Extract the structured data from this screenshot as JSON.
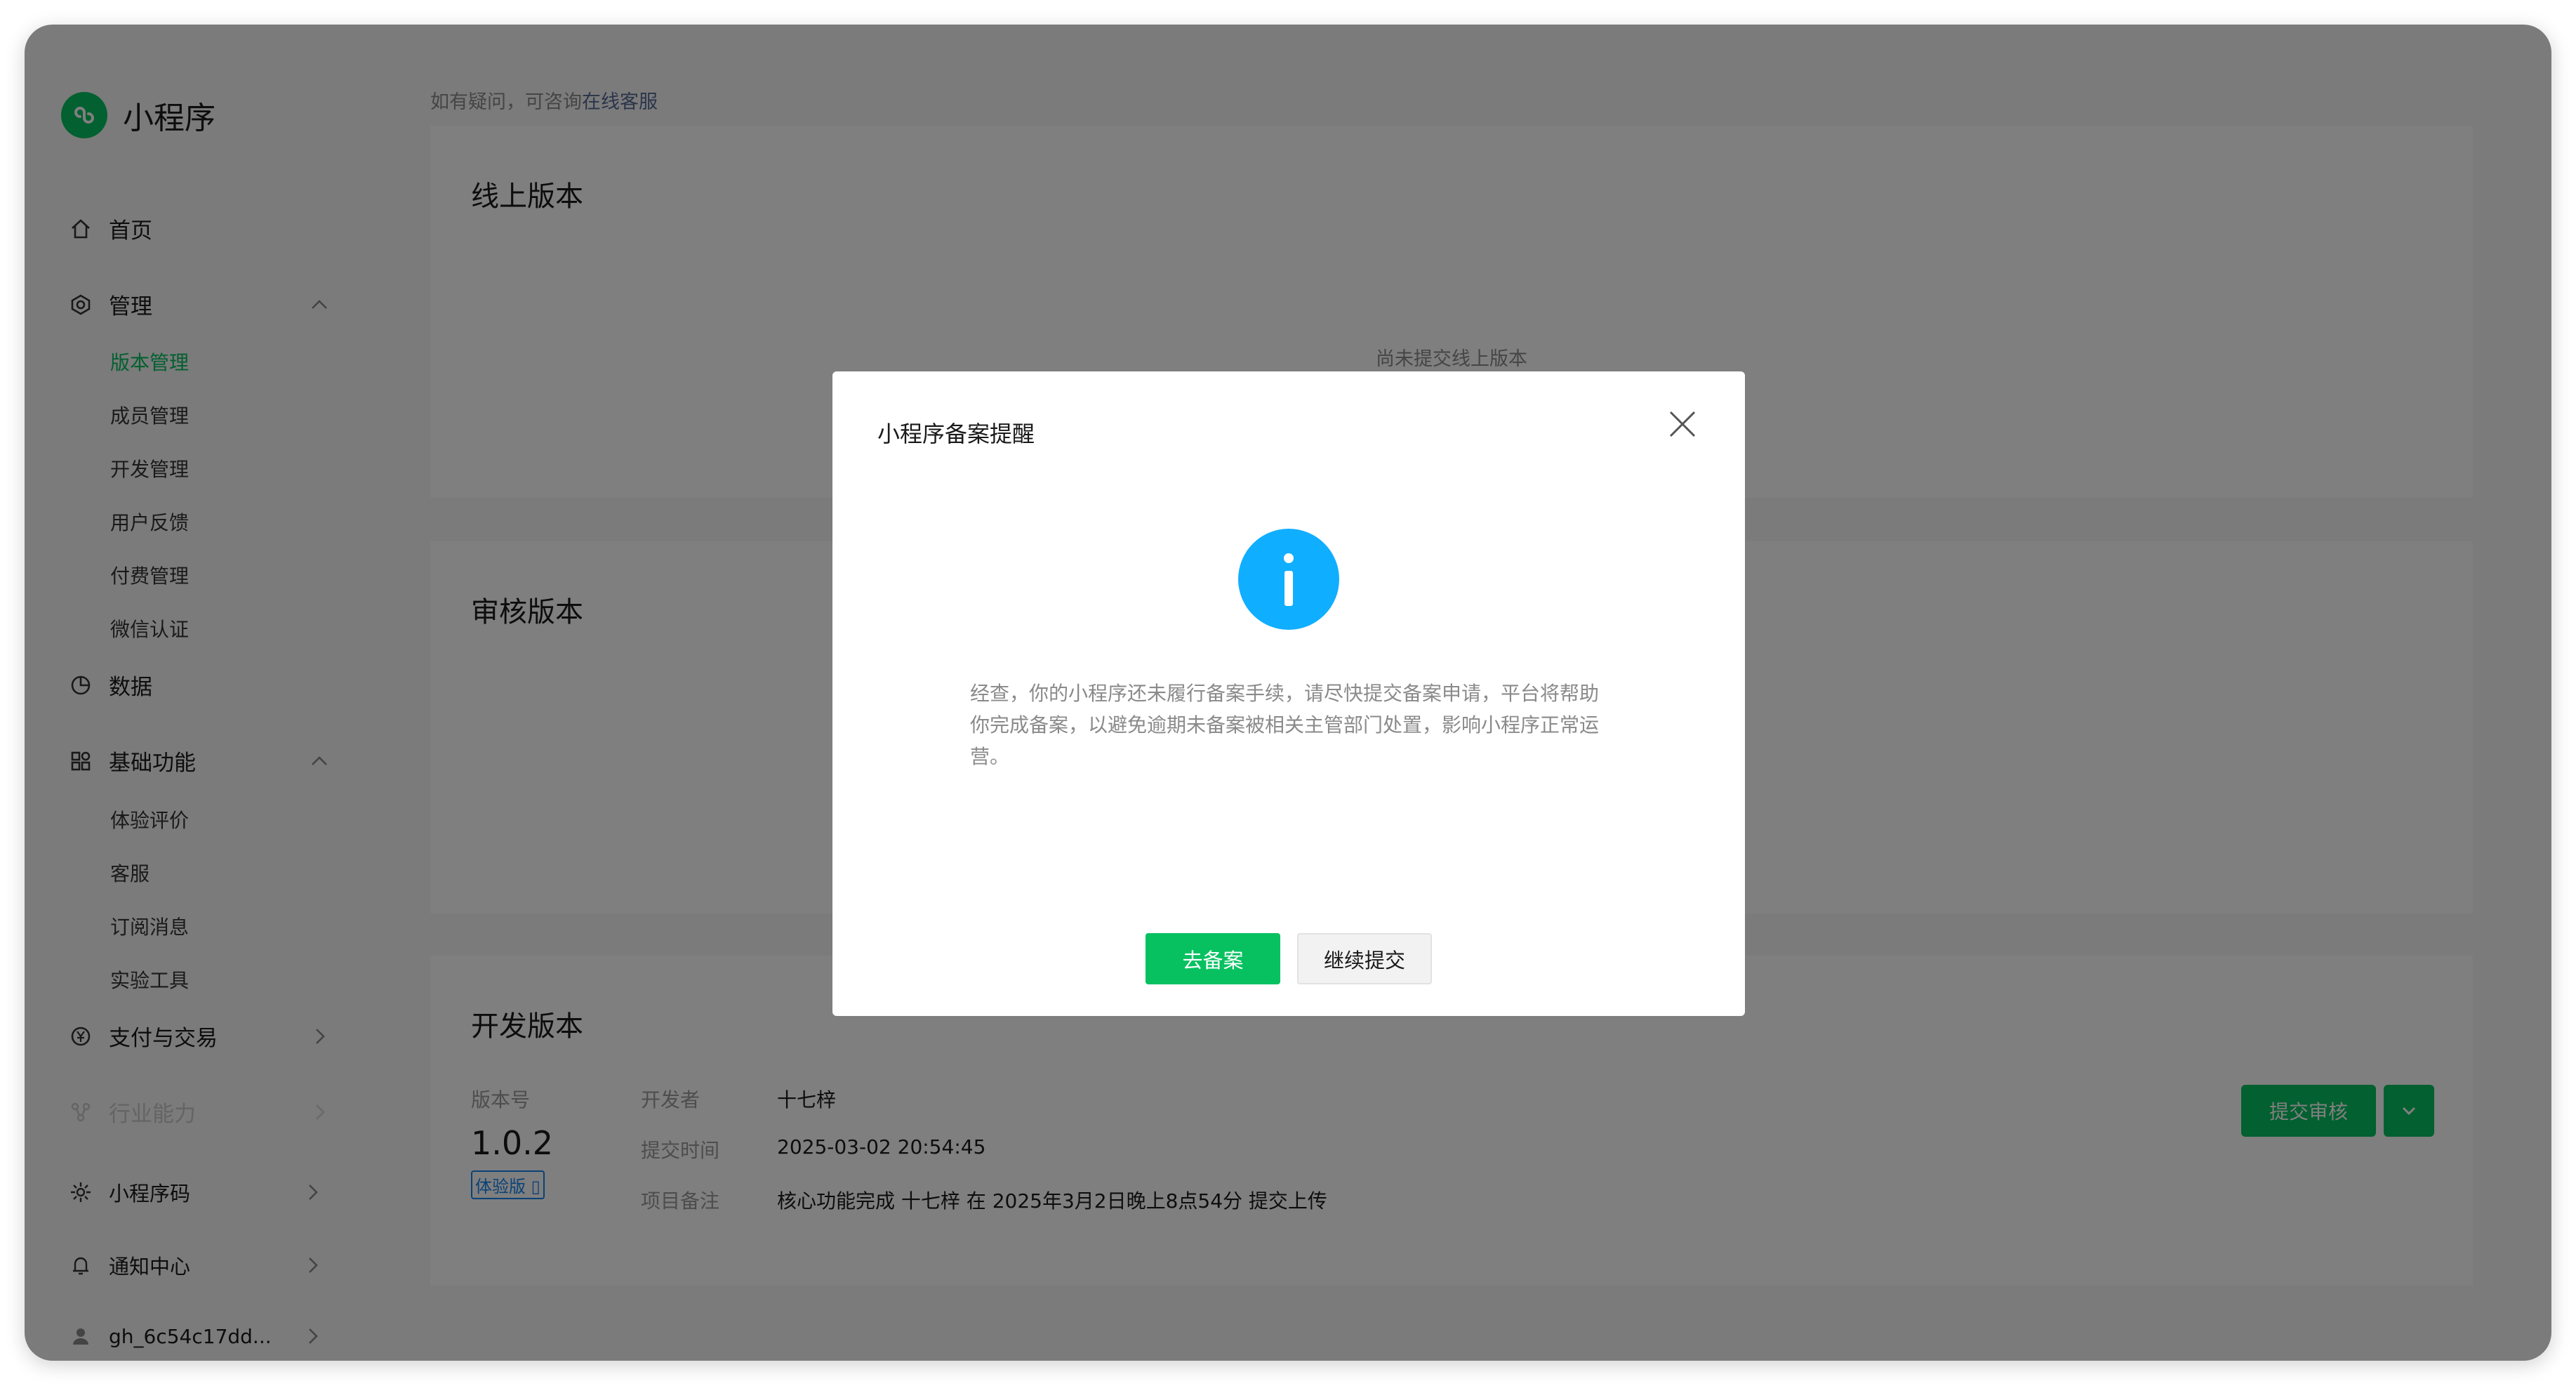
{
  "app": {
    "name": "小程序"
  },
  "sidebar": {
    "items": [
      {
        "label": "首页",
        "icon": "home-icon"
      },
      {
        "label": "管理",
        "icon": "settings-hex-icon",
        "expanded": true,
        "children": [
          "版本管理",
          "成员管理",
          "开发管理",
          "用户反馈",
          "付费管理",
          "微信认证"
        ],
        "active_child": "版本管理"
      },
      {
        "label": "数据",
        "icon": "pie-chart-icon"
      },
      {
        "label": "基础功能",
        "icon": "grid-icon",
        "expanded": true,
        "children": [
          "体验评价",
          "客服",
          "订阅消息",
          "实验工具"
        ]
      },
      {
        "label": "支付与交易",
        "icon": "yen-circle-icon"
      },
      {
        "label": "行业能力",
        "icon": "nodes-icon",
        "disabled": true
      },
      {
        "label": "小程序码",
        "icon": "sun-code-icon"
      },
      {
        "label": "通知中心",
        "icon": "bell-icon"
      },
      {
        "label": "gh_6c54c17dd...",
        "icon": "user-icon"
      }
    ]
  },
  "main": {
    "hint_prefix": "如有疑问，可咨询",
    "hint_link": "在线客服",
    "online": {
      "title": "线上版本",
      "empty": "尚未提交线上版本"
    },
    "review": {
      "title": "审核版本"
    },
    "dev": {
      "title": "开发版本",
      "version_label": "版本号",
      "version": "1.0.2",
      "version_tag": "体验版 ▯",
      "developer_label": "开发者",
      "developer": "十七梓",
      "time_label": "提交时间",
      "time": "2025-03-02 20:54:45",
      "note_label": "项目备注",
      "note": "核心功能完成 十七梓 在 2025年3月2日晚上8点54分 提交上传",
      "submit_label": "提交审核"
    }
  },
  "dialog": {
    "title": "小程序备案提醒",
    "body": "经查，你的小程序还未履行备案手续，请尽快提交备案申请，平台将帮助你完成备案，以避免逾期未备案被相关主管部门处置，影响小程序正常运营。",
    "primary_label": "去备案",
    "secondary_label": "继续提交"
  },
  "colors": {
    "brand": "#07c160",
    "info": "#10aeff",
    "link": "#576b95",
    "tag": "#1485ee"
  }
}
